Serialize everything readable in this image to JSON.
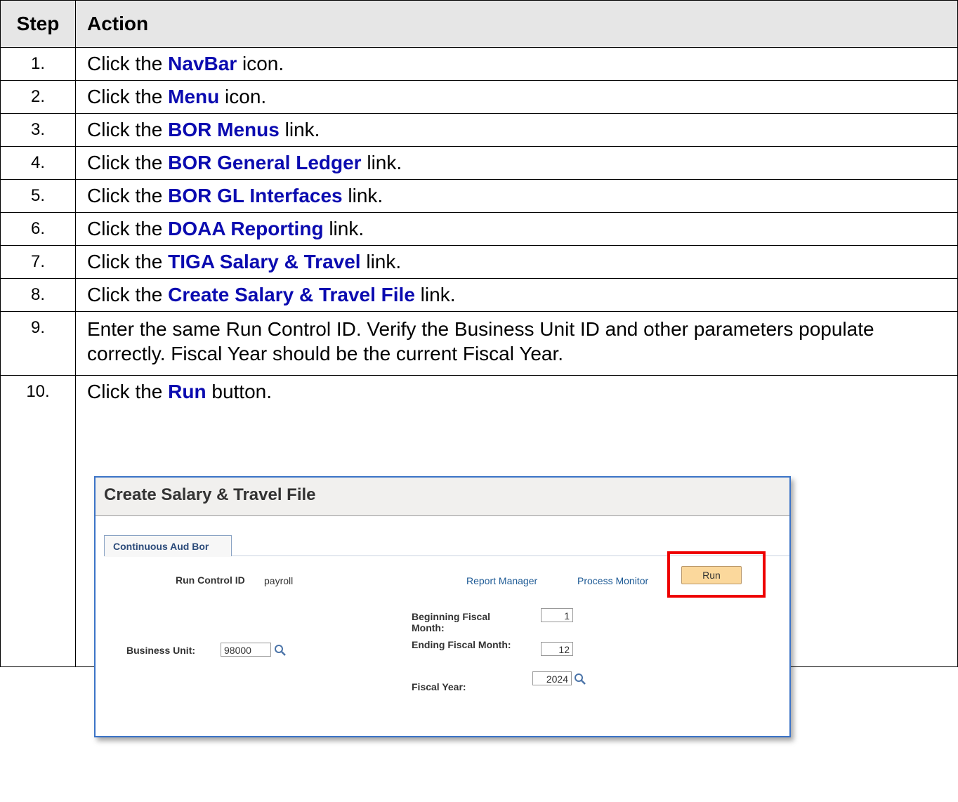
{
  "header": {
    "step": "Step",
    "action": "Action"
  },
  "rows": [
    {
      "num": "1.",
      "pre": "Click the ",
      "link": "NavBar",
      "post": " icon."
    },
    {
      "num": "2.",
      "pre": "Click the ",
      "link": "Menu",
      "post": " icon."
    },
    {
      "num": "3.",
      "pre": "Click the ",
      "link": "BOR Menus",
      "post": " link."
    },
    {
      "num": "4.",
      "pre": "Click the ",
      "link": "BOR General Ledger",
      "post": " link."
    },
    {
      "num": "5.",
      "pre": "Click the ",
      "link": "BOR GL Interfaces",
      "post": " link."
    },
    {
      "num": "6.",
      "pre": "Click the ",
      "link": "DOAA Reporting",
      "post": " link."
    },
    {
      "num": "7.",
      "pre": "Click the ",
      "link": "TIGA Salary & Travel",
      "post": " link."
    },
    {
      "num": "8.",
      "pre": "Click the ",
      "link": "Create Salary & Travel File",
      "post": " link."
    }
  ],
  "row9": {
    "num": "9.",
    "text": "Enter the same Run Control ID. Verify the Business Unit ID and other parameters populate correctly. Fiscal Year should be the current Fiscal Year."
  },
  "row10": {
    "num": "10.",
    "pre": "Click the ",
    "link": "Run",
    "post": " button."
  },
  "screenshot": {
    "title": "Create Salary & Travel File",
    "tab": "Continuous Aud Bor",
    "run_control_label": "Run Control ID",
    "run_control_value": "payroll",
    "report_manager": "Report Manager",
    "process_monitor": "Process Monitor",
    "run_button": "Run",
    "business_unit_label": "Business Unit:",
    "business_unit_value": "98000",
    "beginning_month_label_1": "Beginning Fiscal",
    "beginning_month_label_2": "Month:",
    "beginning_month_value": "1",
    "ending_month_label": "Ending Fiscal Month:",
    "ending_month_value": "12",
    "fiscal_year_label": "Fiscal Year:",
    "fiscal_year_value": "2024"
  },
  "colors": {
    "link_blue": "#0b0bb0",
    "highlight_red": "#ee0000",
    "run_button": "#fbd89c"
  }
}
